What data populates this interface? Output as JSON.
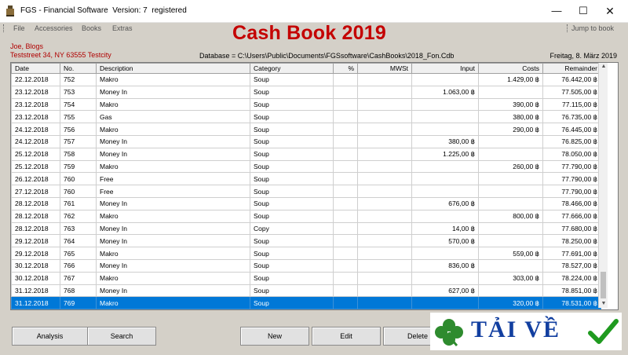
{
  "window": {
    "title": "FGS - Financial Software  Version: 7  registered",
    "min_glyph": "—",
    "max_glyph": "☐",
    "close_glyph": "✕"
  },
  "menu": {
    "items": [
      {
        "label": "File"
      },
      {
        "label": "Accessories"
      },
      {
        "label": "Books"
      },
      {
        "label": "Extras"
      }
    ],
    "jump_label": "Jump to book"
  },
  "header": {
    "book_title": "Cash Book 2019",
    "owner_name": "Joe, Blogs",
    "owner_address": "Teststreet 34, NY 63555 Testcity",
    "database_path": "Database = C:\\Users\\Public\\Documents\\FGSsoftware\\CashBooks\\2018_Fon.Cdb",
    "current_date": "Freitag, 8. März 2019"
  },
  "table": {
    "columns": [
      "Date",
      "No.",
      "Description",
      "Category",
      "%",
      "MWSt",
      "Input",
      "Costs",
      "Remainder"
    ],
    "rows": [
      [
        "22.12.2018",
        "752",
        "Makro",
        "Soup",
        "",
        "",
        "",
        "1.429,00 ฿",
        "76.442,00 ฿"
      ],
      [
        "23.12.2018",
        "753",
        "Money In",
        "Soup",
        "",
        "",
        "1.063,00 ฿",
        "",
        "77.505,00 ฿"
      ],
      [
        "23.12.2018",
        "754",
        "Makro",
        "Soup",
        "",
        "",
        "",
        "390,00 ฿",
        "77.115,00 ฿"
      ],
      [
        "23.12.2018",
        "755",
        "Gas",
        "Soup",
        "",
        "",
        "",
        "380,00 ฿",
        "76.735,00 ฿"
      ],
      [
        "24.12.2018",
        "756",
        "Makro",
        "Soup",
        "",
        "",
        "",
        "290,00 ฿",
        "76.445,00 ฿"
      ],
      [
        "24.12.2018",
        "757",
        "Money In",
        "Soup",
        "",
        "",
        "380,00 ฿",
        "",
        "76.825,00 ฿"
      ],
      [
        "25.12.2018",
        "758",
        "Money In",
        "Soup",
        "",
        "",
        "1.225,00 ฿",
        "",
        "78.050,00 ฿"
      ],
      [
        "25.12.2018",
        "759",
        "Makro",
        "Soup",
        "",
        "",
        "",
        "260,00 ฿",
        "77.790,00 ฿"
      ],
      [
        "26.12.2018",
        "760",
        "Free",
        "Soup",
        "",
        "",
        "",
        "",
        "77.790,00 ฿"
      ],
      [
        "27.12.2018",
        "760",
        "Free",
        "Soup",
        "",
        "",
        "",
        "",
        "77.790,00 ฿"
      ],
      [
        "28.12.2018",
        "761",
        "Money In",
        "Soup",
        "",
        "",
        "676,00 ฿",
        "",
        "78.466,00 ฿"
      ],
      [
        "28.12.2018",
        "762",
        "Makro",
        "Soup",
        "",
        "",
        "",
        "800,00 ฿",
        "77.666,00 ฿"
      ],
      [
        "28.12.2018",
        "763",
        "Money In",
        "Copy",
        "",
        "",
        "14,00 ฿",
        "",
        "77.680,00 ฿"
      ],
      [
        "29.12.2018",
        "764",
        "Money In",
        "Soup",
        "",
        "",
        "570,00 ฿",
        "",
        "78.250,00 ฿"
      ],
      [
        "29.12.2018",
        "765",
        "Makro",
        "Soup",
        "",
        "",
        "",
        "559,00 ฿",
        "77.691,00 ฿"
      ],
      [
        "30.12.2018",
        "766",
        "Money In",
        "Soup",
        "",
        "",
        "836,00 ฿",
        "",
        "78.527,00 ฿"
      ],
      [
        "30.12.2018",
        "767",
        "Makro",
        "Soup",
        "",
        "",
        "",
        "303,00 ฿",
        "78.224,00 ฿"
      ],
      [
        "31.12.2018",
        "768",
        "Money In",
        "Soup",
        "",
        "",
        "627,00 ฿",
        "",
        "78.851,00 ฿"
      ],
      [
        "31.12.2018",
        "769",
        "Makro",
        "Soup",
        "",
        "",
        "",
        "320,00 ฿",
        "78.531,00 ฿"
      ]
    ],
    "selected_row_index": 18
  },
  "buttons": {
    "analysis": "Analysis",
    "search": "Search",
    "new": "New",
    "edit": "Edit",
    "delete": "Delete"
  },
  "watermark": {
    "text": "TẢI VỀ",
    "clover_color": "#2e8b2e",
    "check_color": "#1f9a1f"
  },
  "colors": {
    "title_red": "#c40000",
    "selection_blue": "#0078d7"
  },
  "icons": {
    "app": "fgs-app-icon",
    "scroll_up": "scroll-up-arrow-icon",
    "scroll_down": "scroll-down-arrow-icon"
  }
}
